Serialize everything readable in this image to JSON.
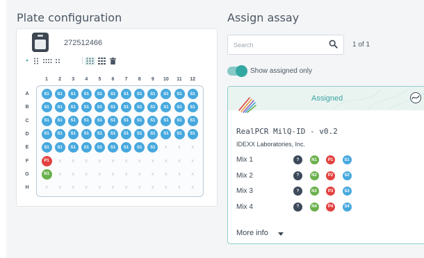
{
  "plate_config": {
    "title": "Plate configuration",
    "plate_id": "272512466",
    "columns": [
      "1",
      "2",
      "3",
      "4",
      "5",
      "6",
      "7",
      "8",
      "9",
      "10",
      "11",
      "12"
    ],
    "rows": [
      "A",
      "B",
      "C",
      "D",
      "E",
      "F",
      "G",
      "H"
    ],
    "wells": [
      [
        "S1",
        "S1",
        "S1",
        "S1",
        "S1",
        "S1",
        "S1",
        "S1",
        "S1",
        "S1",
        "S1",
        "S1"
      ],
      [
        "S1",
        "S1",
        "S1",
        "S1",
        "S1",
        "S1",
        "S1",
        "S1",
        "S1",
        "S1",
        "S1",
        "S1"
      ],
      [
        "S1",
        "S1",
        "S1",
        "S1",
        "S1",
        "S1",
        "S1",
        "S1",
        "S1",
        "S1",
        "S1",
        "S1"
      ],
      [
        "S1",
        "S1",
        "S1",
        "S1",
        "S1",
        "S1",
        "S1",
        "S1",
        "S1",
        "S1",
        "S1",
        "S1"
      ],
      [
        "S1",
        "S1",
        "S1",
        "S1",
        "S1",
        "S1",
        "S1",
        "S1",
        "S1",
        "x",
        "x",
        "x"
      ],
      [
        "P1",
        "x",
        "x",
        "x",
        "x",
        "x",
        "x",
        "x",
        "x",
        "x",
        "x",
        "x"
      ],
      [
        "N1",
        "x",
        "x",
        "x",
        "x",
        "x",
        "x",
        "x",
        "x",
        "x",
        "x",
        "x"
      ],
      [
        "x",
        "x",
        "x",
        "x",
        "x",
        "x",
        "x",
        "x",
        "x",
        "x",
        "x",
        "x"
      ]
    ]
  },
  "colors": {
    "sample": "#46a8de",
    "positive": "#e2413f",
    "negative": "#6ab04c",
    "unknown": "#3d4a5a",
    "accent": "#33a8a3"
  },
  "assign": {
    "title": "Assign assay",
    "search_placeholder": "Search",
    "pager": "1 of 1",
    "toggle_label": "Show assigned only",
    "toggle_on": true
  },
  "assay": {
    "status": "Assigned",
    "name": "RealPCR MilQ-ID - v0.2",
    "vendor": "IDEXX Laboratories, Inc.",
    "mixes": [
      {
        "label": "Mix 1",
        "chips": [
          "?",
          "N1",
          "P1",
          "S1"
        ]
      },
      {
        "label": "Mix 2",
        "chips": [
          "?",
          "N2",
          "P2",
          "S2"
        ]
      },
      {
        "label": "Mix 3",
        "chips": [
          "?",
          "N3",
          "P3",
          "S3"
        ]
      },
      {
        "label": "Mix 4",
        "chips": [
          "?",
          "N4",
          "P4",
          "S4"
        ]
      }
    ],
    "more_info": "More info"
  },
  "icons": {
    "search": "search-icon",
    "plate": "plate-icon",
    "delete": "trash-icon",
    "more": "chevron-down-icon",
    "layout": "grid-layout-icon"
  }
}
